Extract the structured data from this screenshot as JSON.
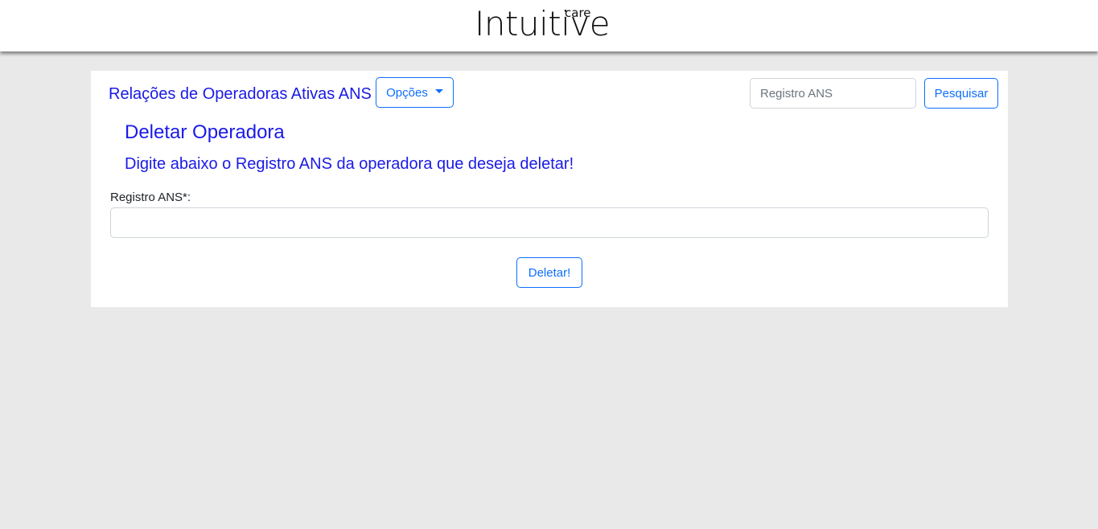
{
  "header": {
    "logo_main": "Intuitive",
    "logo_sup": "care"
  },
  "navbar": {
    "brand": "Relações de Operadoras Ativas ANS",
    "options_button": "Opções",
    "search_placeholder": "Registro ANS",
    "search_value": "",
    "search_button": "Pesquisar"
  },
  "form": {
    "title": "Deletar Operadora",
    "subtitle": "Digite abaixo o Registro ANS da operadora que deseja deletar!",
    "field_label": "Registro ANS*:",
    "field_value": "",
    "submit_button": "Deletar!"
  },
  "colors": {
    "accent": "#0d6efd",
    "heading": "#1a1ae6",
    "background": "#e9e9e9"
  }
}
